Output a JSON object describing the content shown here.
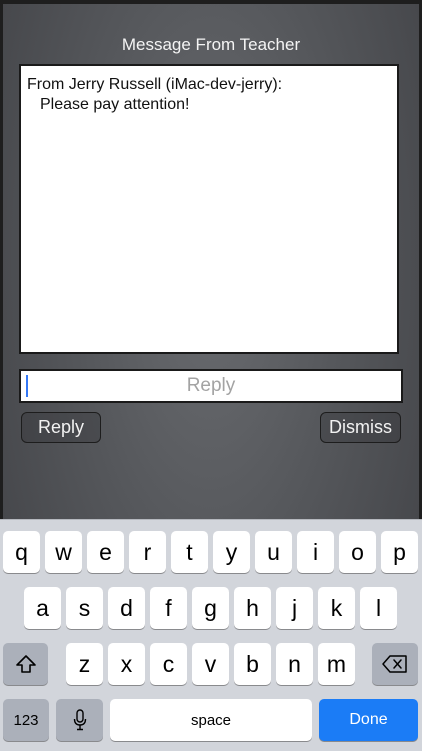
{
  "dialog": {
    "title": "Message From Teacher",
    "message_line1": "From Jerry Russell (iMac-dev-jerry):",
    "message_line2": "Please pay attention!",
    "reply_placeholder": "Reply",
    "reply_value": "",
    "reply_button": "Reply",
    "dismiss_button": "Dismiss"
  },
  "keyboard": {
    "row1": [
      "q",
      "w",
      "e",
      "r",
      "t",
      "y",
      "u",
      "i",
      "o",
      "p"
    ],
    "row2": [
      "a",
      "s",
      "d",
      "f",
      "g",
      "h",
      "j",
      "k",
      "l"
    ],
    "row3": [
      "z",
      "x",
      "c",
      "v",
      "b",
      "n",
      "m"
    ],
    "shift_icon": "shift-icon",
    "delete_icon": "backspace-icon",
    "numbers_label": "123",
    "mic_icon": "microphone-icon",
    "space_label": "space",
    "done_label": "Done"
  },
  "colors": {
    "accent": "#1b7cf6",
    "keyboard_bg": "#d2d5db",
    "key_bg": "#ffffff",
    "function_key_bg": "#abb0ba"
  }
}
